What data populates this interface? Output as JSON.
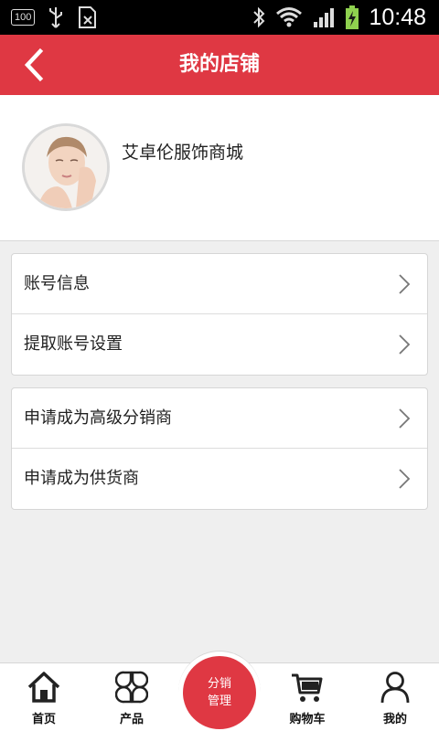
{
  "status_bar": {
    "battery_badge": "100",
    "time": "10:48"
  },
  "header": {
    "title": "我的店铺"
  },
  "profile": {
    "shop_name": "艾卓伦服饰商城"
  },
  "menu_groups": [
    {
      "items": [
        {
          "label": "账号信息"
        },
        {
          "label": "提取账号设置"
        }
      ]
    },
    {
      "items": [
        {
          "label": "申请成为高级分销商"
        },
        {
          "label": "申请成为供货商"
        }
      ]
    }
  ],
  "tabbar": {
    "home": "首页",
    "products": "产品",
    "center_line1": "分销",
    "center_line2": "管理",
    "cart": "购物车",
    "mine": "我的"
  },
  "colors": {
    "accent": "#df3843"
  }
}
